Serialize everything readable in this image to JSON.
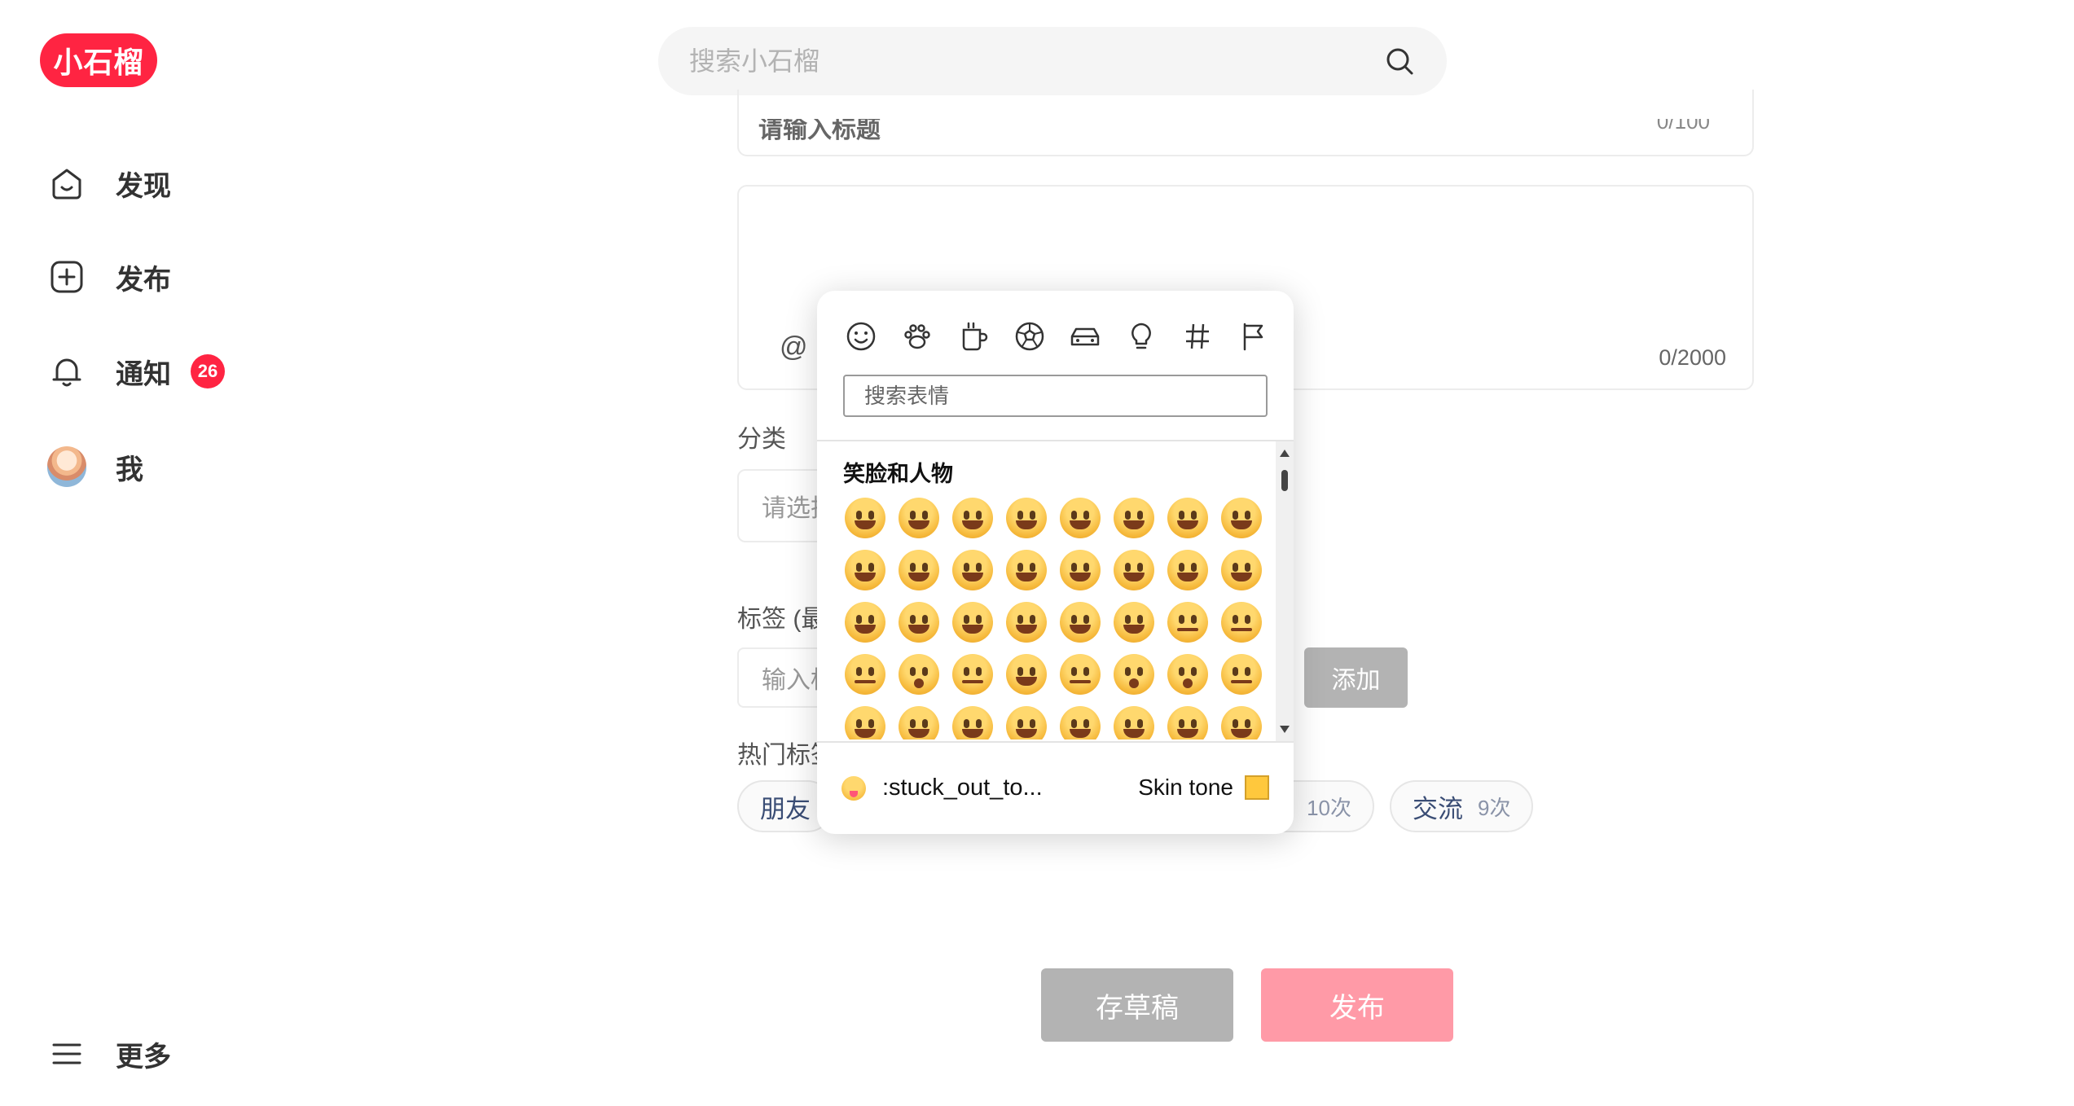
{
  "logo": {
    "text": "小石榴"
  },
  "top_search": {
    "placeholder": "搜索小石榴"
  },
  "sidebar": {
    "items": [
      {
        "label": "发现"
      },
      {
        "label": "发布"
      },
      {
        "label": "通知",
        "badge": "26"
      },
      {
        "label": "我"
      }
    ],
    "more_label": "更多"
  },
  "form": {
    "title_placeholder": "请输入标题",
    "title_counter": "0/100",
    "content_at": "@",
    "content_counter": "0/2000",
    "category_label": "分类",
    "category_placeholder": "请选择",
    "tags_label": "标签 (最",
    "tag_input_placeholder": "输入标",
    "add_button": "添加",
    "hot_tags_label": "热门标签",
    "hot_tags": [
      {
        "name": "朋友",
        "count": ""
      },
      {
        "name": "",
        "count": "10次"
      },
      {
        "name": "交流",
        "count": "9次"
      }
    ],
    "draft_button": "存草稿",
    "publish_button": "发布"
  },
  "emoji_picker": {
    "categories": [
      "smiley-icon",
      "paw-icon",
      "cup-icon",
      "ball-icon",
      "car-icon",
      "bulb-icon",
      "hash-icon",
      "flag-icon"
    ],
    "search_placeholder": "搜索表情",
    "section_title": "笑脸和人物",
    "preview_name": ":stuck_out_to...",
    "skin_tone_label": "Skin tone",
    "skin_tone_color": "#ffc83d"
  },
  "colors": {
    "brand": "#ff2442",
    "publish_disabled": "#ff9aa7",
    "button_disabled": "#b3b3b3"
  }
}
